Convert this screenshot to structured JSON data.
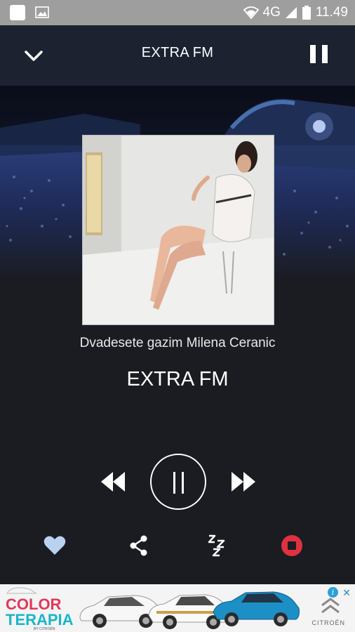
{
  "status_bar": {
    "network": "4G",
    "time": "11.49"
  },
  "header": {
    "title": "EXTRA FM"
  },
  "now_playing": {
    "song": "Dvadesete gazim Milena Ceranic",
    "station": "EXTRA FM"
  },
  "icons": {
    "collapse": "chevron-down-icon",
    "top_pause": "pause-icon",
    "rewind": "rewind-icon",
    "play_pause": "pause-circle-icon",
    "forward": "fast-forward-icon",
    "favorite": "heart-icon",
    "share": "share-icon",
    "sleep": "sleep-timer-icon",
    "stop": "stop-icon"
  },
  "ad": {
    "brand_line1": "COLOR",
    "brand_line2": "TERAPIA",
    "sub": "BY CITROËN",
    "logo": "CITROËN",
    "info": "i",
    "close": "✕"
  },
  "colors": {
    "header_bg": "#1d2231",
    "page_bg": "#1b1c22",
    "stop_red": "#e0313f",
    "ad_pink": "#e2375a",
    "ad_teal": "#1bb5c9"
  }
}
